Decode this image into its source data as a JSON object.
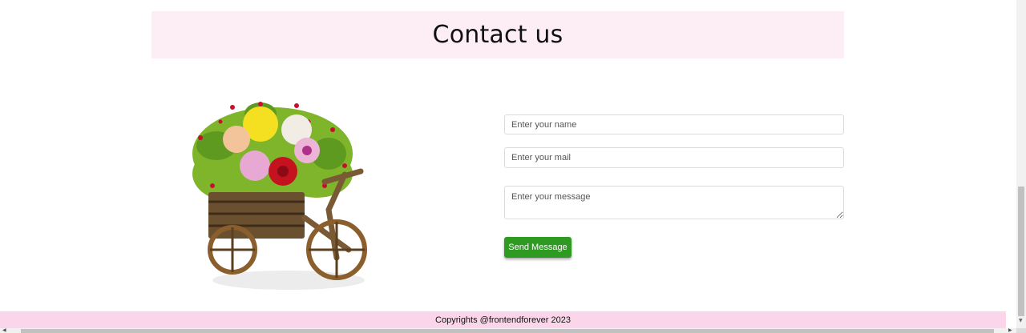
{
  "header": {
    "title": "Contact us"
  },
  "illustration": {
    "icon": "flower-cart-illustration"
  },
  "form": {
    "name_placeholder": "Enter your name",
    "mail_placeholder": "Enter your mail",
    "message_placeholder": "Enter your message",
    "submit_label": "Send Message"
  },
  "footer": {
    "text": "Copyrights @frontendforever 2023"
  },
  "colors": {
    "header_band": "#fdeef6",
    "footer_band": "#fbd6ea",
    "button": "#2e9a22"
  }
}
